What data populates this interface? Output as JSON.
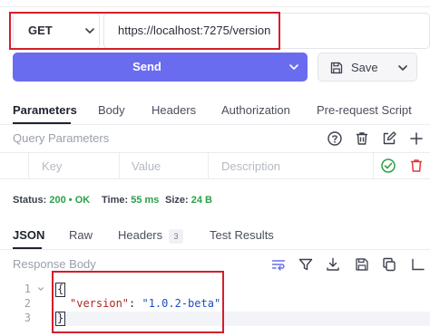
{
  "request": {
    "method": "GET",
    "url": "https://localhost:7275/version"
  },
  "actions": {
    "send_label": "Send",
    "save_label": "Save"
  },
  "request_tabs": [
    "Parameters",
    "Body",
    "Headers",
    "Authorization",
    "Pre-request Script"
  ],
  "query": {
    "title": "Query Parameters",
    "key_placeholder": "Key",
    "value_placeholder": "Value",
    "description_placeholder": "Description"
  },
  "status": {
    "status_label": "Status:",
    "status_code": "200",
    "status_sep": "•",
    "status_text": "OK",
    "time_label": "Time:",
    "time_value": "55 ms",
    "size_label": "Size:",
    "size_value": "24 B"
  },
  "response_tabs": {
    "json": "JSON",
    "raw": "Raw",
    "headers": "Headers",
    "headers_count": "3",
    "tests": "Test Results"
  },
  "response_body": {
    "title": "Response Body",
    "line_numbers": [
      "1",
      "2",
      "3"
    ],
    "open_brace": "{",
    "key": "\"version\"",
    "colon": ": ",
    "value": "\"1.0.2-beta\"",
    "close_brace": "}"
  },
  "colors": {
    "accent": "#6a6cf0",
    "highlight_box": "#d21f2b",
    "ok_green": "#2aa147",
    "delete_red": "#e03a3a"
  }
}
